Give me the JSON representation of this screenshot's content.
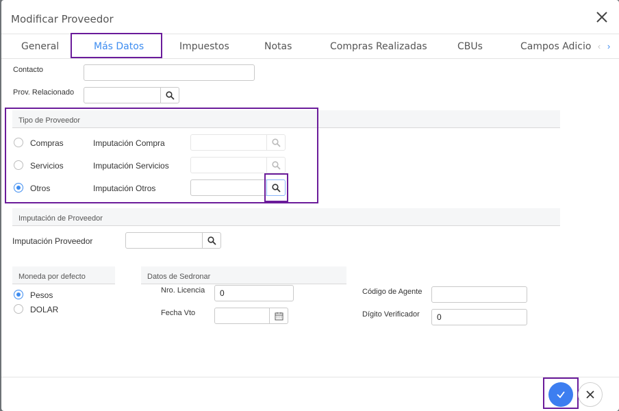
{
  "header": {
    "title": "Modificar Proveedor"
  },
  "tabs": [
    {
      "label": "General"
    },
    {
      "label": "Más Datos",
      "active": true
    },
    {
      "label": "Impuestos"
    },
    {
      "label": "Notas"
    },
    {
      "label": "Compras Realizadas"
    },
    {
      "label": "CBUs"
    },
    {
      "label": "Campos Adicionales"
    }
  ],
  "contacto": {
    "label": "Contacto",
    "value": ""
  },
  "prov_relacionado": {
    "label": "Prov. Relacionado",
    "value": ""
  },
  "tipo_proveedor": {
    "title": "Tipo de Proveedor",
    "options": [
      {
        "label": "Compras",
        "imputacion_label": "Imputación Compra",
        "value": "",
        "checked": false,
        "enabled": false
      },
      {
        "label": "Servicios",
        "imputacion_label": "Imputación Servicios",
        "value": "",
        "checked": false,
        "enabled": false
      },
      {
        "label": "Otros",
        "imputacion_label": "Imputación Otros",
        "value": "",
        "checked": true,
        "enabled": true
      }
    ]
  },
  "imputacion_proveedor": {
    "title": "Imputación de Proveedor",
    "label": "Imputación Proveedor",
    "value": ""
  },
  "moneda": {
    "title": "Moneda por defecto",
    "options": [
      {
        "label": "Pesos",
        "checked": true
      },
      {
        "label": "DOLAR",
        "checked": false
      }
    ]
  },
  "sedronar": {
    "title": "Datos de Sedronar",
    "nro_licencia": {
      "label": "Nro. Licencia",
      "value": "0"
    },
    "fecha_vto": {
      "label": "Fecha Vto",
      "value": ""
    },
    "codigo_agente": {
      "label": "Código de Agente",
      "value": ""
    },
    "digito_verificador": {
      "label": "Dígito Verificador",
      "value": "0"
    }
  },
  "colors": {
    "accent": "#3d8cf0",
    "highlight": "#6a1b9a",
    "ok": "#3d7ef0"
  },
  "icons": [
    "close-icon",
    "search-icon",
    "calendar-icon",
    "check-icon",
    "chevron-left-icon",
    "chevron-right-icon"
  ]
}
